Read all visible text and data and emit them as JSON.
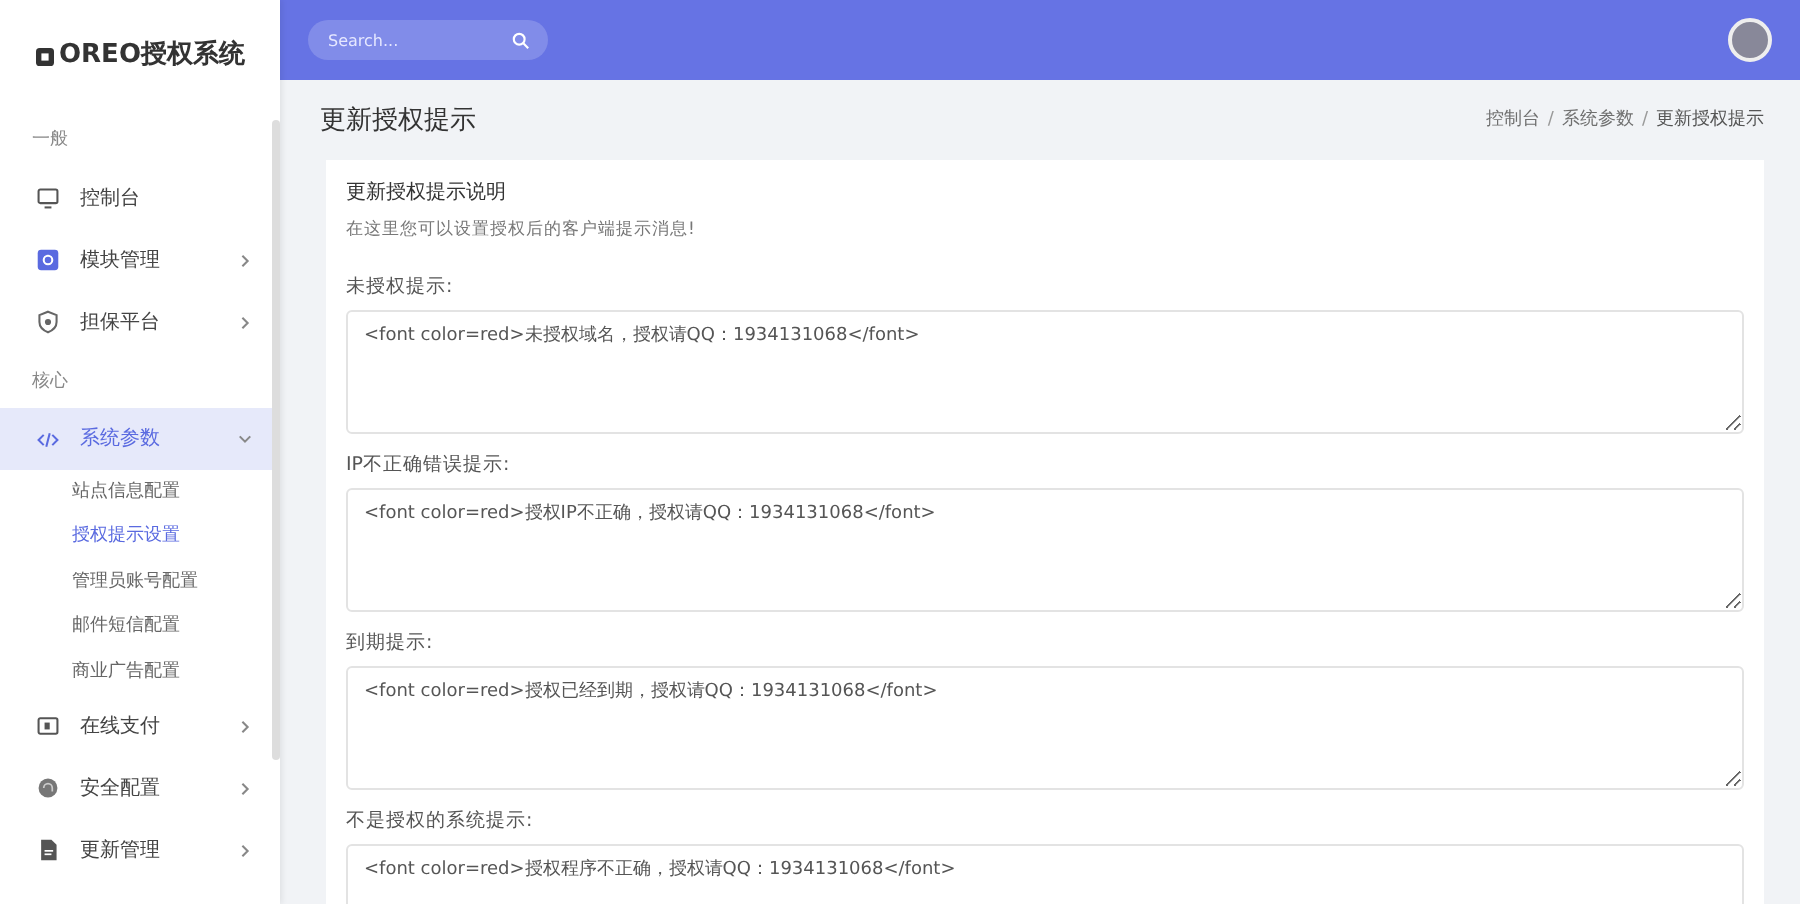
{
  "sidebar": {
    "logo": "OREO授权系统",
    "sections": [
      {
        "heading": "一般",
        "items": [
          {
            "label": "控制台",
            "selected": false
          },
          {
            "label": "模块管理",
            "selected": false,
            "expanded": false
          },
          {
            "label": "担保平台",
            "selected": false,
            "expanded": false
          }
        ]
      },
      {
        "heading": "核心",
        "items": [
          {
            "label": "系统参数",
            "selected": true,
            "expanded": true,
            "children": [
              {
                "label": "站点信息配置",
                "selected": false
              },
              {
                "label": "授权提示设置",
                "selected": true
              },
              {
                "label": "管理员账号配置",
                "selected": false
              },
              {
                "label": "邮件短信配置",
                "selected": false
              },
              {
                "label": "商业广告配置",
                "selected": false
              }
            ]
          },
          {
            "label": "在线支付",
            "selected": false,
            "expanded": false
          },
          {
            "label": "安全配置",
            "selected": false,
            "expanded": false
          },
          {
            "label": "更新管理",
            "selected": false,
            "expanded": false
          }
        ]
      }
    ]
  },
  "topbar": {
    "search": {
      "placeholder": "Search..."
    }
  },
  "page": {
    "title": "更新授权提示",
    "breadcrumb": [
      {
        "text": "控制台",
        "kind": "link"
      },
      {
        "text": "/",
        "kind": "separator"
      },
      {
        "text": "系统参数",
        "kind": "link"
      },
      {
        "text": "/",
        "kind": "separator"
      },
      {
        "text": "更新授权提示",
        "kind": "current"
      }
    ]
  },
  "card": {
    "heading": "更新授权提示说明",
    "description": "在这里您可以设置授权后的客户端提示消息!",
    "fields": [
      {
        "label": "未授权提示:",
        "value": "<font color=red>未授权域名，授权请QQ：1934131068</font>"
      },
      {
        "label": "IP不正确错误提示:",
        "value": "<font color=red>授权IP不正确，授权请QQ：1934131068</font>"
      },
      {
        "label": "到期提示:",
        "value": "<font color=red>授权已经到期，授权请QQ：1934131068</font>"
      },
      {
        "label": "不是授权的系统提示:",
        "value": "<font color=red>授权程序不正确，授权请QQ：1934131068</font>"
      }
    ]
  }
}
